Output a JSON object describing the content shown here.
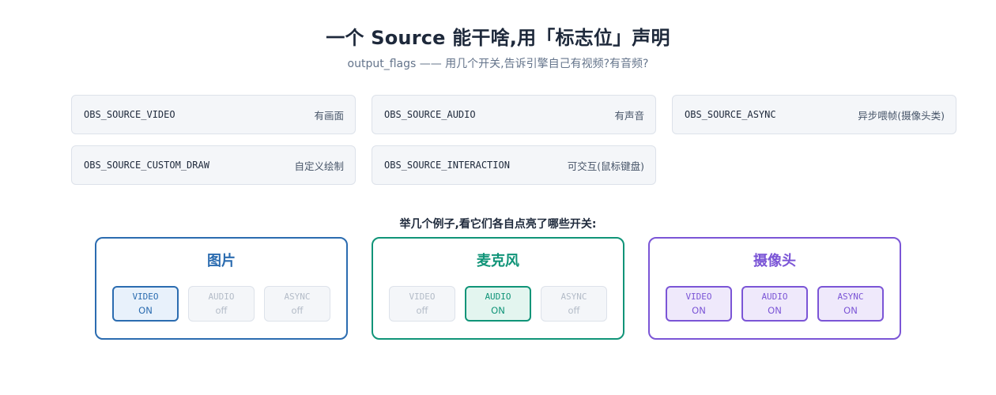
{
  "header": {
    "title": "一个 Source 能干啥,用「标志位」声明",
    "subtitle": "output_flags —— 用几个开关,告诉引擎自己有视频?有音频?"
  },
  "flags": [
    {
      "name": "OBS_SOURCE_VIDEO",
      "desc": "有画面"
    },
    {
      "name": "OBS_SOURCE_AUDIO",
      "desc": "有声音"
    },
    {
      "name": "OBS_SOURCE_ASYNC",
      "desc": "异步喂帧(摄像头类)"
    },
    {
      "name": "OBS_SOURCE_CUSTOM_DRAW",
      "desc": "自定义绘制"
    },
    {
      "name": "OBS_SOURCE_INTERACTION",
      "desc": "可交互(鼠标键盘)"
    }
  ],
  "examples_title": "举几个例子,看它们各自点亮了哪些开关:",
  "examples": [
    {
      "name": "图片",
      "color": "#2b6cb0",
      "on_bg": "#e8f1fb",
      "switches": [
        {
          "label": "VIDEO",
          "state": "ON",
          "on": true
        },
        {
          "label": "AUDIO",
          "state": "off",
          "on": false
        },
        {
          "label": "ASYNC",
          "state": "off",
          "on": false
        }
      ]
    },
    {
      "name": "麦克风",
      "color": "#109478",
      "on_bg": "#e3f5ef",
      "switches": [
        {
          "label": "VIDEO",
          "state": "off",
          "on": false
        },
        {
          "label": "AUDIO",
          "state": "ON",
          "on": true
        },
        {
          "label": "ASYNC",
          "state": "off",
          "on": false
        }
      ]
    },
    {
      "name": "摄像头",
      "color": "#7b55d6",
      "on_bg": "#efe9fb",
      "switches": [
        {
          "label": "VIDEO",
          "state": "ON",
          "on": true
        },
        {
          "label": "AUDIO",
          "state": "ON",
          "on": true
        },
        {
          "label": "ASYNC",
          "state": "ON",
          "on": true
        }
      ]
    }
  ]
}
